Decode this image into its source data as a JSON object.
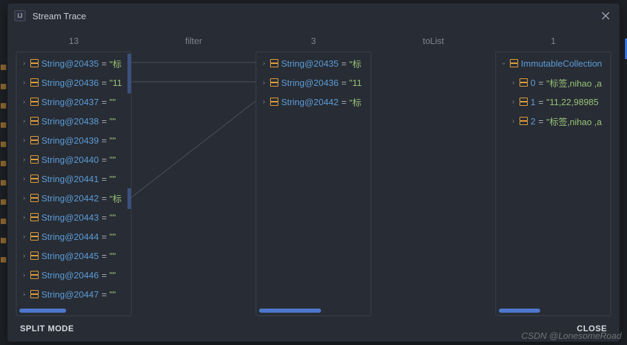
{
  "dialog": {
    "title": "Stream Trace",
    "logo_text": "IJ"
  },
  "headers": {
    "count1": "13",
    "op1": "filter",
    "count2": "3",
    "op2": "toList",
    "count3": "1"
  },
  "col1": {
    "items": [
      {
        "name": "String@20435",
        "value": "\"标"
      },
      {
        "name": "String@20436",
        "value": "\"11"
      },
      {
        "name": "String@20437",
        "value": "\"\""
      },
      {
        "name": "String@20438",
        "value": "\"\""
      },
      {
        "name": "String@20439",
        "value": "\"\""
      },
      {
        "name": "String@20440",
        "value": "\"\""
      },
      {
        "name": "String@20441",
        "value": "\"\""
      },
      {
        "name": "String@20442",
        "value": "\"标"
      },
      {
        "name": "String@20443",
        "value": "\"\""
      },
      {
        "name": "String@20444",
        "value": "\"\""
      },
      {
        "name": "String@20445",
        "value": "\"\""
      },
      {
        "name": "String@20446",
        "value": "\"\""
      },
      {
        "name": "String@20447",
        "value": "\"\""
      }
    ]
  },
  "col2": {
    "items": [
      {
        "name": "String@20435",
        "value": "\"标"
      },
      {
        "name": "String@20436",
        "value": "\"11"
      },
      {
        "name": "String@20442",
        "value": "\"标"
      }
    ]
  },
  "col3": {
    "root": {
      "name": "ImmutableCollection"
    },
    "items": [
      {
        "key": "0",
        "value": "\"标签,nihao ,a"
      },
      {
        "key": "1",
        "value": "\"11,22,98985"
      },
      {
        "key": "2",
        "value": "\"标签,nihao ,a"
      }
    ]
  },
  "footer": {
    "left": "SPLIT MODE",
    "right": "CLOSE"
  },
  "watermark": "CSDN @LonesomeRoad"
}
